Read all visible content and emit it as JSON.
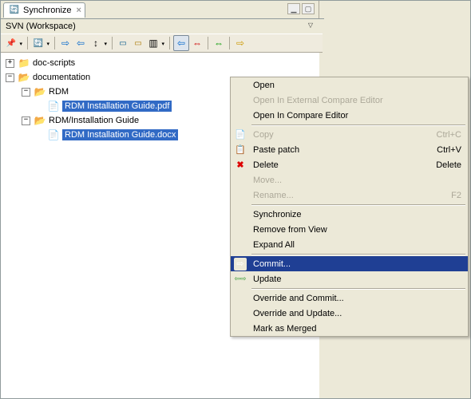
{
  "tab": {
    "title": "Synchronize"
  },
  "workspace_label": "SVN (Workspace)",
  "tree": {
    "nodes": [
      {
        "label": "doc-scripts"
      },
      {
        "label": "documentation"
      },
      {
        "label": "RDM"
      },
      {
        "label": "RDM Installation Guide.pdf"
      },
      {
        "label": "RDM/Installation Guide"
      },
      {
        "label": "RDM Installation Guide.docx"
      }
    ]
  },
  "menu": {
    "open": "Open",
    "open_external": "Open In External Compare Editor",
    "open_compare": "Open In Compare Editor",
    "copy": "Copy",
    "copy_key": "Ctrl+C",
    "paste": "Paste patch",
    "paste_key": "Ctrl+V",
    "delete": "Delete",
    "delete_key": "Delete",
    "move": "Move...",
    "rename": "Rename...",
    "rename_key": "F2",
    "synchronize": "Synchronize",
    "remove": "Remove from View",
    "expand": "Expand All",
    "commit": "Commit...",
    "update": "Update",
    "override_commit": "Override and Commit...",
    "override_update": "Override and Update...",
    "mark_merged": "Mark as Merged"
  }
}
